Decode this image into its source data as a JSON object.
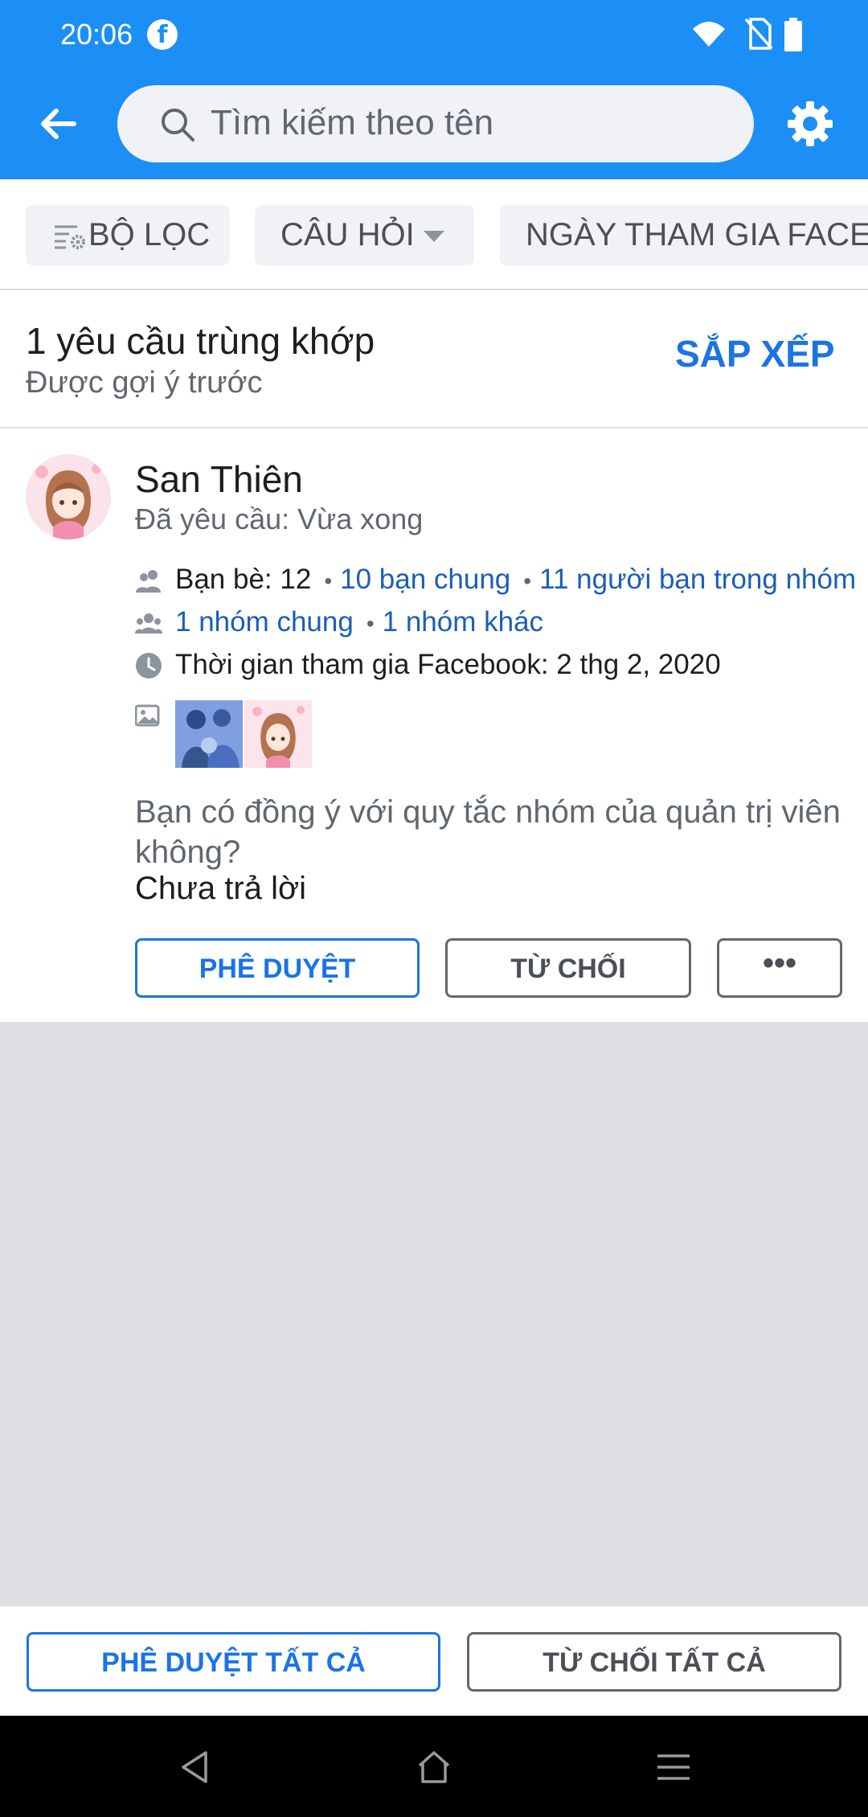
{
  "status_bar": {
    "time": "20:06"
  },
  "search": {
    "placeholder": "Tìm kiếm theo tên"
  },
  "filters": {
    "filter_label": "BỘ LỌC",
    "question_label": "CÂU HỎI",
    "join_date_label": "NGÀY THAM GIA FACE"
  },
  "results": {
    "count_text": "1 yêu cầu trùng khớp",
    "subtitle": "Được gợi ý trước",
    "sort_label": "SẮP XẾP"
  },
  "request": {
    "name": "San Thiên",
    "requested": "Đã yêu cầu: Vừa xong",
    "friends": "Bạn bè: 12",
    "mutual_friends": "10 bạn chung",
    "friends_in_group": "11 người bạn trong nhóm",
    "mutual_groups": "1 nhóm chung",
    "other_groups": "1 nhóm khác",
    "joined_facebook": "Thời gian tham gia Facebook: 2 thg 2, 2020",
    "question": "Bạn có đồng ý với quy tắc nhóm của quản trị viên không?",
    "answer": "Chưa trả lời",
    "approve_label": "PHÊ DUYỆT",
    "decline_label": "TỪ CHỐI",
    "more_label": "•••"
  },
  "bottom_actions": {
    "approve_all_label": "PHÊ DUYỆT TẤT CẢ",
    "decline_all_label": "TỪ CHỐI TẤT CẢ"
  },
  "colors": {
    "header_blue": "#1b8ff5",
    "link_blue": "#1b5fb4",
    "button_blue": "#1b74e4"
  },
  "icons": [
    "facebook-icon",
    "wifi-icon",
    "no-sim-icon",
    "battery-icon",
    "back-arrow-icon",
    "search-icon",
    "gear-icon",
    "filter-icon",
    "caret-down-icon",
    "friends-icon",
    "groups-icon",
    "clock-icon",
    "photos-icon",
    "nav-back-icon",
    "nav-home-icon",
    "nav-menu-icon"
  ]
}
